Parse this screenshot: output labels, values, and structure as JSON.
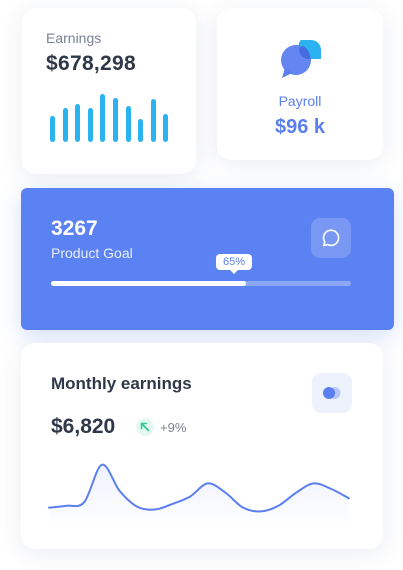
{
  "earnings": {
    "label": "Earnings",
    "value": "$678,298",
    "bars": [
      0.55,
      0.7,
      0.8,
      0.7,
      1.0,
      0.92,
      0.75,
      0.48,
      0.9,
      0.58
    ],
    "bar_color": "#2ab3f0"
  },
  "payroll": {
    "label": "Payroll",
    "value": "$96 k",
    "icon": "chat-bubbles-icon",
    "accent": "#5b7ff0"
  },
  "goal": {
    "value": "3267",
    "label": "Product Goal",
    "percent_label": "65%",
    "progress": 0.65,
    "icon": "chat-icon",
    "background": "#5b82f2"
  },
  "monthly": {
    "title": "Monthly earnings",
    "value": "$6,820",
    "change": "+9%",
    "trend_icon": "arrow-up-left-icon",
    "toggle_icon": "toggle-icon",
    "line_color": "#5b7ff0",
    "series": [
      10,
      12,
      16,
      56,
      28,
      11,
      8,
      14,
      22,
      36,
      26,
      10,
      6,
      12,
      26,
      36,
      30,
      20
    ]
  }
}
